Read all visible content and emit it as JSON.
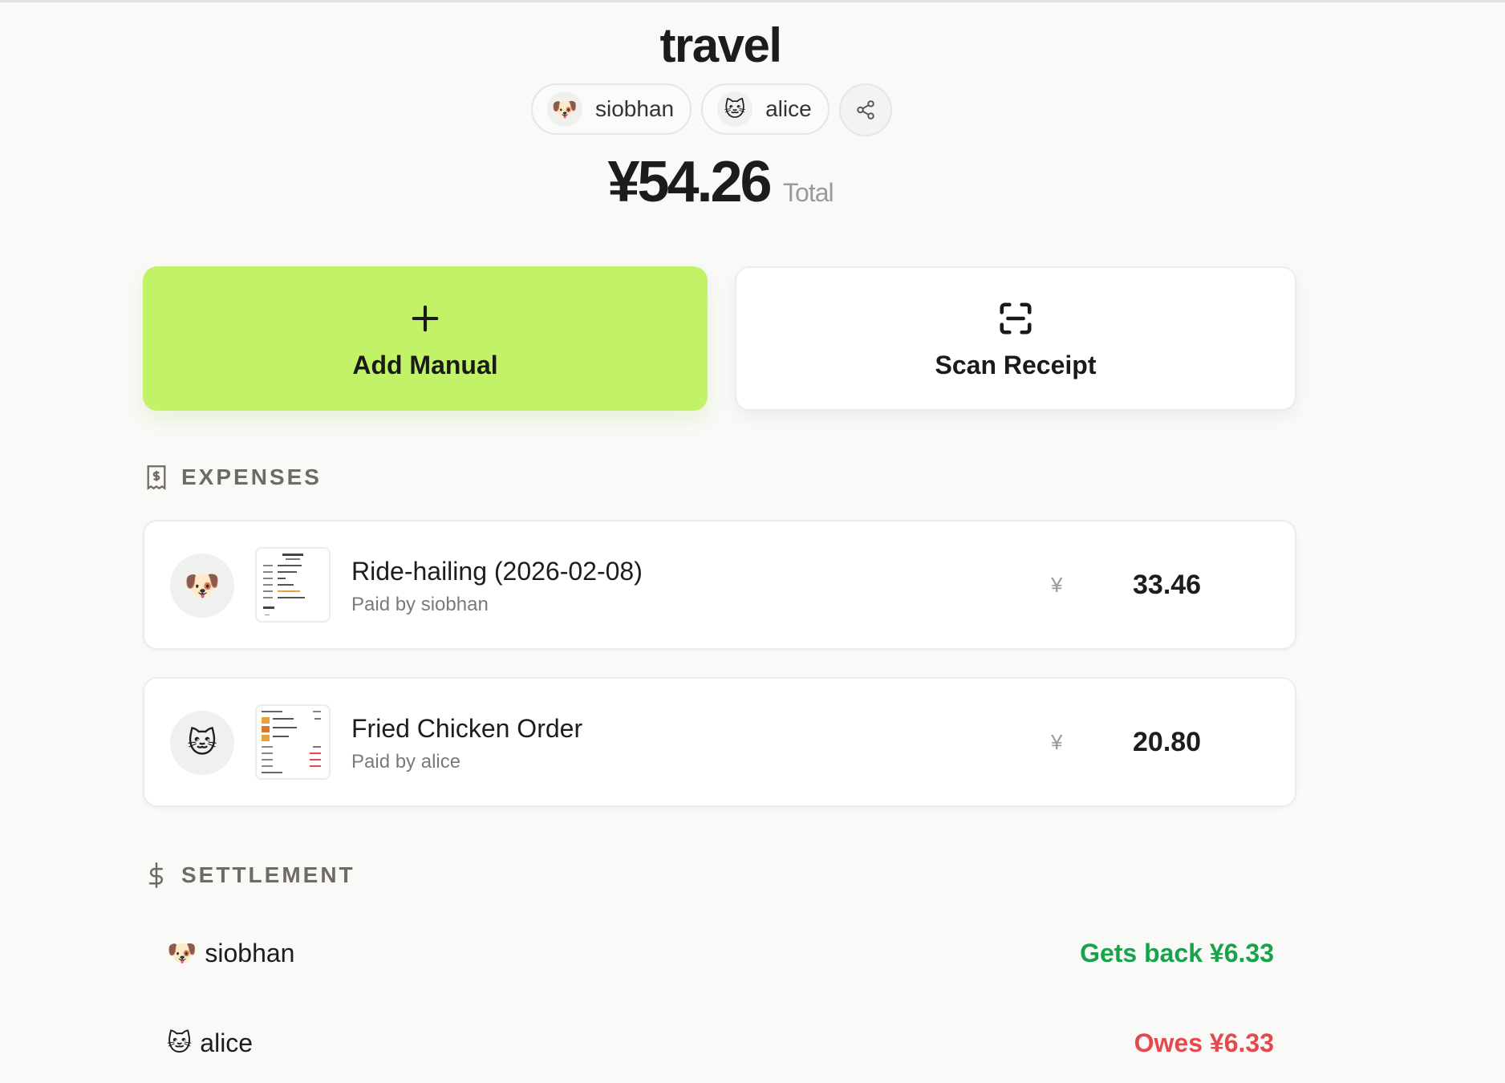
{
  "group": {
    "title": "travel",
    "members": [
      {
        "name": "siobhan",
        "emoji": "🐶",
        "icon": "dog-face-icon"
      },
      {
        "name": "alice",
        "emoji": "🐱",
        "icon": "cat-face-icon"
      }
    ],
    "total_amount": "¥54.26",
    "total_label": "Total"
  },
  "actions": {
    "add_label": "Add Manual",
    "scan_label": "Scan Receipt"
  },
  "expenses": {
    "heading": "EXPENSES",
    "items": [
      {
        "title": "Ride-hailing (2026-02-08)",
        "paid_by": "Paid by siobhan",
        "payer_emoji": "🐶",
        "currency": "¥",
        "amount": "33.46"
      },
      {
        "title": "Fried Chicken Order",
        "paid_by": "Paid by alice",
        "payer_emoji": "🐱",
        "currency": "¥",
        "amount": "20.80"
      }
    ]
  },
  "settlement": {
    "heading": "SETTLEMENT",
    "rows": [
      {
        "emoji": "🐶",
        "name": "siobhan",
        "status": "Gets back ¥6.33"
      },
      {
        "emoji": "🐱",
        "name": "alice",
        "status": "Owes ¥6.33"
      }
    ]
  },
  "colors": {
    "accent_green": "#c2f267",
    "positive": "#17a34a",
    "negative": "#e5484d"
  }
}
